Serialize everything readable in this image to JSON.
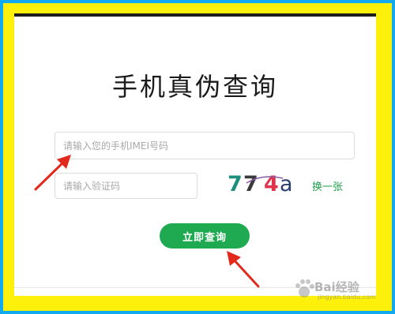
{
  "page": {
    "title": "手机真伪查询"
  },
  "form": {
    "imei_placeholder": "请输入您的手机IMEI号码",
    "imei_value": "",
    "code_placeholder": "请输入验证码",
    "code_value": "",
    "captcha_chars": [
      {
        "char": "7",
        "color": "#1e8f7d"
      },
      {
        "char": "7",
        "color": "#3a3a3a"
      },
      {
        "char": "4",
        "color": "#e0324a"
      },
      {
        "char": "a",
        "color": "#2a3d6e"
      }
    ],
    "refresh_label": "换一张",
    "submit_label": "立即查询"
  },
  "watermark": {
    "text": "Bai经验",
    "sub": "jingyan.baidu.com"
  },
  "colors": {
    "outer_border": "#12a9ef",
    "inner_frame": "#fdf10c",
    "accent_green": "#1faa51",
    "annotation_red": "#e22a1c"
  }
}
